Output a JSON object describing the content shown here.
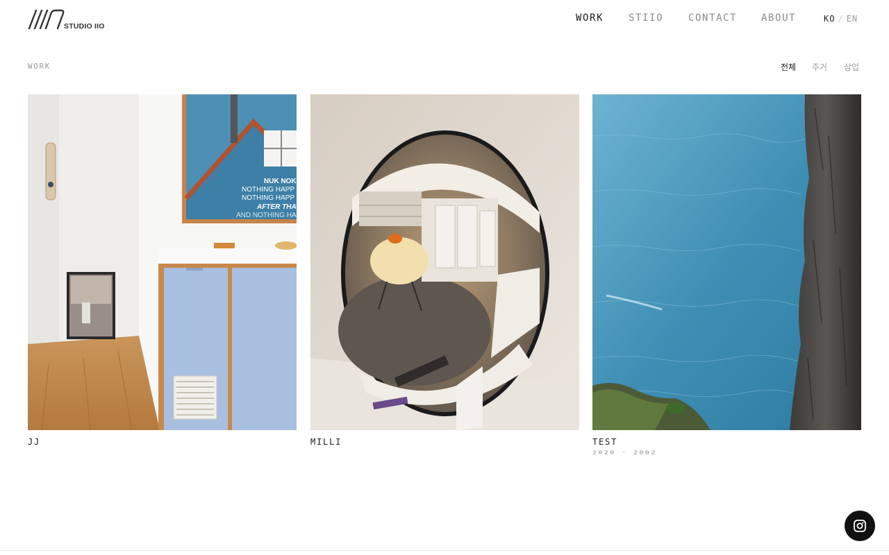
{
  "header": {
    "logo_text": "STUDIO IIO",
    "nav": [
      {
        "label": "WORK",
        "active": true
      },
      {
        "label": "STIIO",
        "active": false
      },
      {
        "label": "CONTACT",
        "active": false
      },
      {
        "label": "ABOUT",
        "active": false
      }
    ],
    "lang": {
      "ko": "KO",
      "separator": "/",
      "en": "EN"
    }
  },
  "subbar": {
    "section_label": "WORK",
    "filters": [
      {
        "label": "전체",
        "active": true
      },
      {
        "label": "주거",
        "active": false
      },
      {
        "label": "상업",
        "active": false
      }
    ]
  },
  "projects": [
    {
      "title": "JJ",
      "date": "",
      "image": "kitchen-interior-photo"
    },
    {
      "title": "MILLI",
      "date": "",
      "image": "convex-mirror-reflection-photo"
    },
    {
      "title": "TEST",
      "date": "2020 · 2002",
      "image": "ocean-cliff-aerial-photo"
    }
  ],
  "social": {
    "icon": "instagram-icon"
  },
  "colors": {
    "text_primary": "#1a1a1a",
    "text_muted": "#8a8a8a",
    "instagram_bg": "#111111"
  }
}
